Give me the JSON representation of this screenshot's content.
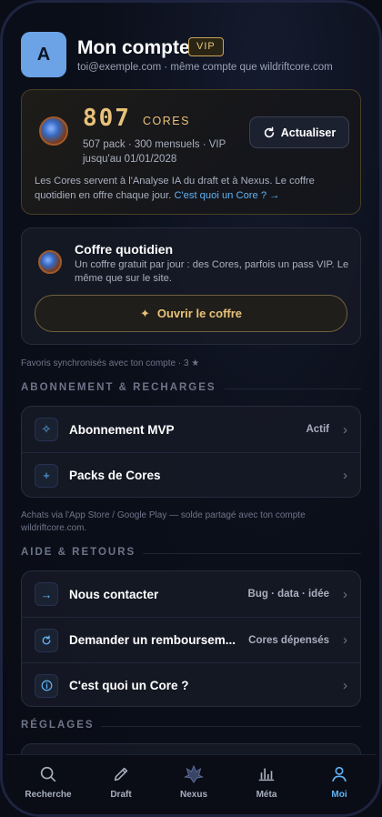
{
  "header": {
    "avatar_letter": "A",
    "title": "Mon compte",
    "badge": "VIP",
    "subtitle": "toi@exemple.com · même compte que wildriftcore.com"
  },
  "cores": {
    "amount": "807",
    "label": "CORES",
    "meta_line1": "507 pack · 300 mensuels · VIP",
    "meta_line2": "jusqu'au 01/01/2028",
    "refresh_label": "Actualiser",
    "description": "Les Cores servent à l'Analyse IA du draft et à Nexus. Le coffre quotidien en offre chaque jour.",
    "link": "C'est quoi un Core ? →"
  },
  "chest": {
    "title": "Coffre quotidien",
    "description": "Un coffre gratuit par jour : des Cores, parfois un pass VIP. Le même que sur le site.",
    "open_label": "Ouvrir le coffre"
  },
  "favorites_note": "Favoris synchronisés avec ton compte · 3 ★",
  "sections": {
    "subscription": {
      "title": "ABONNEMENT & RECHARGES",
      "rows": [
        {
          "label": "Abonnement MVP",
          "value": "Actif",
          "icon": "sparkle-icon"
        },
        {
          "label": "Packs de Cores",
          "value": "",
          "icon": "plus-icon"
        }
      ],
      "note": "Achats via l'App Store / Google Play — solde partagé avec ton compte wildriftcore.com."
    },
    "help": {
      "title": "AIDE & RETOURS",
      "rows": [
        {
          "label": "Nous contacter",
          "value": "Bug · data · idée",
          "icon": "arrow-right-icon"
        },
        {
          "label": "Demander un remboursem...",
          "value": "Cores dépensés",
          "icon": "refresh-icon"
        },
        {
          "label": "C'est quoi un Core ?",
          "value": "",
          "icon": "info-icon"
        }
      ]
    },
    "settings": {
      "title": "RÉGLAGES"
    }
  },
  "tabs": [
    {
      "label": "Recherche",
      "icon": "search-icon"
    },
    {
      "label": "Draft",
      "icon": "pencil-icon"
    },
    {
      "label": "Nexus",
      "icon": "nexus-icon"
    },
    {
      "label": "Méta",
      "icon": "bar-chart-icon"
    },
    {
      "label": "Moi",
      "icon": "user-icon",
      "active": true
    }
  ],
  "colors": {
    "accent_gold": "#e8c27a",
    "accent_blue": "#5fb3f5",
    "background": "#0a0d16"
  }
}
